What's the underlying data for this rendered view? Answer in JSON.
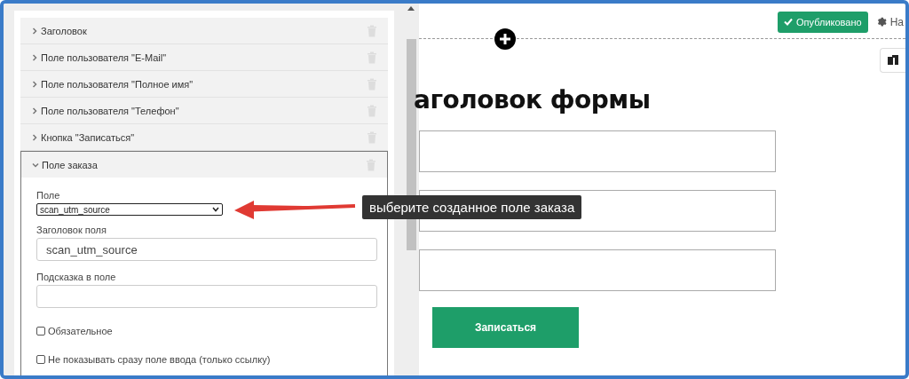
{
  "form_fields_panel": {
    "items": [
      {
        "label": "Заголовок",
        "expanded": false
      },
      {
        "label": "Поле пользователя \"E-Mail\"",
        "expanded": false
      },
      {
        "label": "Поле пользователя \"Полное имя\"",
        "expanded": false
      },
      {
        "label": "Поле пользователя \"Телефон\"",
        "expanded": false
      },
      {
        "label": "Кнопка \"Записаться\"",
        "expanded": false
      },
      {
        "label": "Поле заказа",
        "expanded": true,
        "settings": {
          "field_label": "Поле",
          "field_select_value": "scan_utm_source",
          "title_label": "Заголовок поля",
          "title_value": "scan_utm_source",
          "hint_label": "Подсказка в поле",
          "checkboxes": [
            {
              "label": "Обязательное",
              "checked": false
            },
            {
              "label": "Не показывать сразу поле ввода (только ссылку)",
              "checked": false
            }
          ]
        }
      }
    ]
  },
  "annotation": {
    "text": "выберите созданное поле заказа"
  },
  "canvas": {
    "status_button": "Опубликовано",
    "settings_link": "На",
    "form_title": "аголовок формы",
    "submit_button": "Записаться"
  }
}
